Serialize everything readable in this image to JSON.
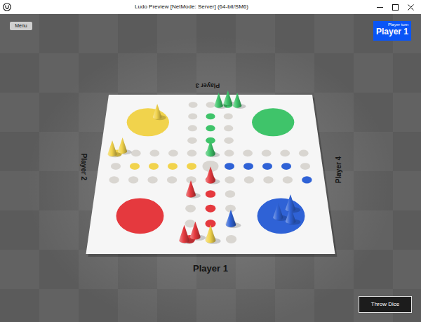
{
  "window": {
    "title": "Ludo Preview [NetMode: Server] (64-bit/SM6)"
  },
  "hud": {
    "menu_button": "Menu",
    "turn": {
      "caption": "Player turn",
      "player": "Player 1",
      "color": "#0a55f6"
    },
    "throw_button": "Throw Dice"
  },
  "board": {
    "players": [
      {
        "label": "Player 1",
        "color": "#e5393e",
        "side": "bottom",
        "pieces": [
          {
            "at": [
              6,
              5
            ]
          },
          {
            "at": [
              7,
              4
            ]
          },
          {
            "at": [
              10,
              4
            ]
          },
          {
            "at": [
              10,
              4
            ]
          }
        ]
      },
      {
        "label": "Player 2",
        "color": "#f1d34c",
        "side": "left",
        "pieces": [
          {
            "at": "home"
          },
          {
            "at": [
              4,
              0
            ]
          },
          {
            "at": [
              4,
              0
            ]
          },
          {
            "at": [
              10,
              5
            ]
          }
        ]
      },
      {
        "label": "Player 3",
        "color": "#3fc46a",
        "side": "top",
        "pieces": [
          {
            "at": [
              0,
              6
            ]
          },
          {
            "at": [
              0,
              6
            ]
          },
          {
            "at": [
              0,
              6
            ]
          },
          {
            "at": [
              4,
              5
            ]
          }
        ]
      },
      {
        "label": "Player 4",
        "color": "#2f62d6",
        "side": "right",
        "pieces": [
          {
            "at": "home"
          },
          {
            "at": "home"
          },
          {
            "at": "home"
          },
          {
            "at": [
              9,
              6
            ]
          }
        ]
      }
    ]
  }
}
